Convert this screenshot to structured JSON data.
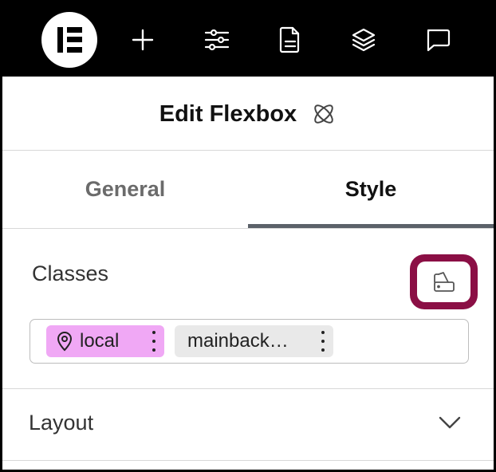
{
  "toolbar": {
    "logo_icon": "elementor-logo-icon",
    "buttons": [
      {
        "icon": "plus-icon"
      },
      {
        "icon": "sliders-icon"
      },
      {
        "icon": "document-icon"
      },
      {
        "icon": "layers-icon"
      },
      {
        "icon": "comment-icon"
      }
    ]
  },
  "header": {
    "title": "Edit Flexbox",
    "title_icon": "atom-icon"
  },
  "tabs": [
    {
      "label": "General",
      "active": false
    },
    {
      "label": "Style",
      "active": true
    }
  ],
  "classes": {
    "label": "Classes",
    "manager_icon": "class-manager-icon",
    "highlight_color": "#8b0f45",
    "chips": [
      {
        "label": "local",
        "icon": "location-pin-icon",
        "color": "#f0a8f5"
      },
      {
        "label": "mainback…",
        "color": "#e9e9e9"
      }
    ]
  },
  "sections": [
    {
      "label": "Layout",
      "icon": "chevron-down-icon",
      "expanded": false
    }
  ]
}
